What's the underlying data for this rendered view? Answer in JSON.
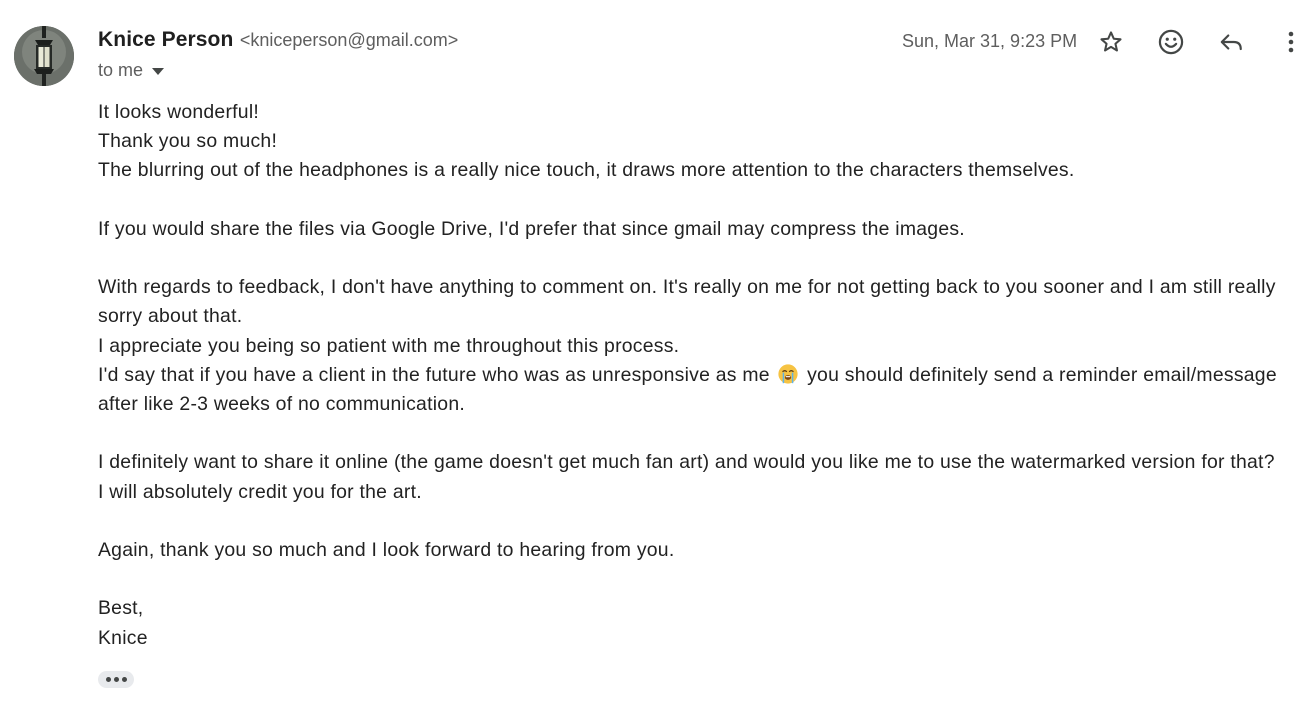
{
  "header": {
    "sender_name": "Knice Person",
    "sender_email": "<kniceperson@gmail.com>",
    "recipient_label": "to me",
    "timestamp": "Sun, Mar 31, 9:23 PM"
  },
  "toolbar": {
    "icons": [
      "star-icon",
      "emoji-reaction-icon",
      "reply-icon",
      "more-options-icon"
    ]
  },
  "message": {
    "lines": [
      "It looks wonderful!",
      "Thank you so much!",
      "The blurring out of the headphones is a really nice touch, it draws more attention to the characters themselves.",
      "If you would share the files via Google Drive, I'd prefer that since gmail may compress the images.",
      "With regards to feedback, I don't have anything to comment on. It's really on me for not getting back to you sooner and I am still really sorry about that.",
      "I appreciate you being so patient with me throughout this process.",
      "I'd say that if you have a client in the future who was as unresponsive as me",
      "you should definitely send a reminder email/message after like 2-3 weeks of no communication.",
      "I definitely want to share it online (the game doesn't get much fan art) and would you like me to use the watermarked version for that?",
      "I will absolutely credit you for the art.",
      "Again, thank you so much and I look forward to hearing from you.",
      "Best,",
      "Knice"
    ],
    "emoji": "loudly-crying-face"
  },
  "colors": {
    "text": "#222222",
    "meta": "#5e5e5e",
    "icon": "#444746"
  }
}
